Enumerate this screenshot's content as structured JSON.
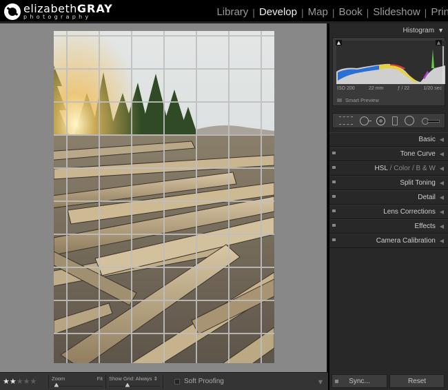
{
  "brand": {
    "name_light": "elizabeth",
    "name_bold": "GRAY",
    "subtitle": "photography",
    "icon": "aperture-logo-icon"
  },
  "modules": [
    {
      "label": "Library",
      "active": false
    },
    {
      "label": "Develop",
      "active": true
    },
    {
      "label": "Map",
      "active": false
    },
    {
      "label": "Book",
      "active": false
    },
    {
      "label": "Slideshow",
      "active": false
    },
    {
      "label": "Prin",
      "active": false
    }
  ],
  "module_separator": "|",
  "photo": {
    "description": "Driftwood logs on a beach with evergreen trees and sunburst",
    "grid_overlay": {
      "columns": 7,
      "rows": 10,
      "visible": true
    }
  },
  "histogram": {
    "title": "Histogram",
    "collapse_icon": "triangle-down-icon",
    "clip_left_icon": "shadow-clipping-icon",
    "clip_right_icon": "highlight-clipping-icon",
    "iso": "ISO 200",
    "focal_length": "22 mm",
    "aperture": "ƒ / 22",
    "shutter": "1/20 sec",
    "smart_preview": "Smart Preview"
  },
  "tool_strip": [
    {
      "name": "crop-overlay-icon"
    },
    {
      "name": "spot-removal-icon"
    },
    {
      "name": "red-eye-icon"
    },
    {
      "name": "graduated-filter-icon"
    },
    {
      "name": "radial-filter-icon"
    },
    {
      "name": "adjustment-brush-icon"
    }
  ],
  "sections": [
    {
      "label": "Basic",
      "switch": false
    },
    {
      "label": "Tone Curve",
      "switch": true
    },
    {
      "label": "HSL",
      "sub": [
        "Color",
        "B & W"
      ],
      "switch": true
    },
    {
      "label": "Split Toning",
      "switch": true
    },
    {
      "label": "Detail",
      "switch": true
    },
    {
      "label": "Lens Corrections",
      "switch": true
    },
    {
      "label": "Effects",
      "switch": true
    },
    {
      "label": "Camera Calibration",
      "switch": true
    }
  ],
  "section_slash": "/",
  "section_arrow": "◀",
  "toolbar": {
    "rating": 2,
    "rating_max": 5,
    "zoom_label": "Zoom",
    "zoom_value": "Fit",
    "zoom_position": 0.05,
    "grid_label": "Show Grid:",
    "grid_value": "Always",
    "grid_position": 0.35,
    "soft_proofing": "Soft Proofing",
    "soft_proofing_checked": false,
    "menu_arrow": "▼"
  },
  "panel_buttons": {
    "sync": "Sync...",
    "reset": "Reset"
  }
}
